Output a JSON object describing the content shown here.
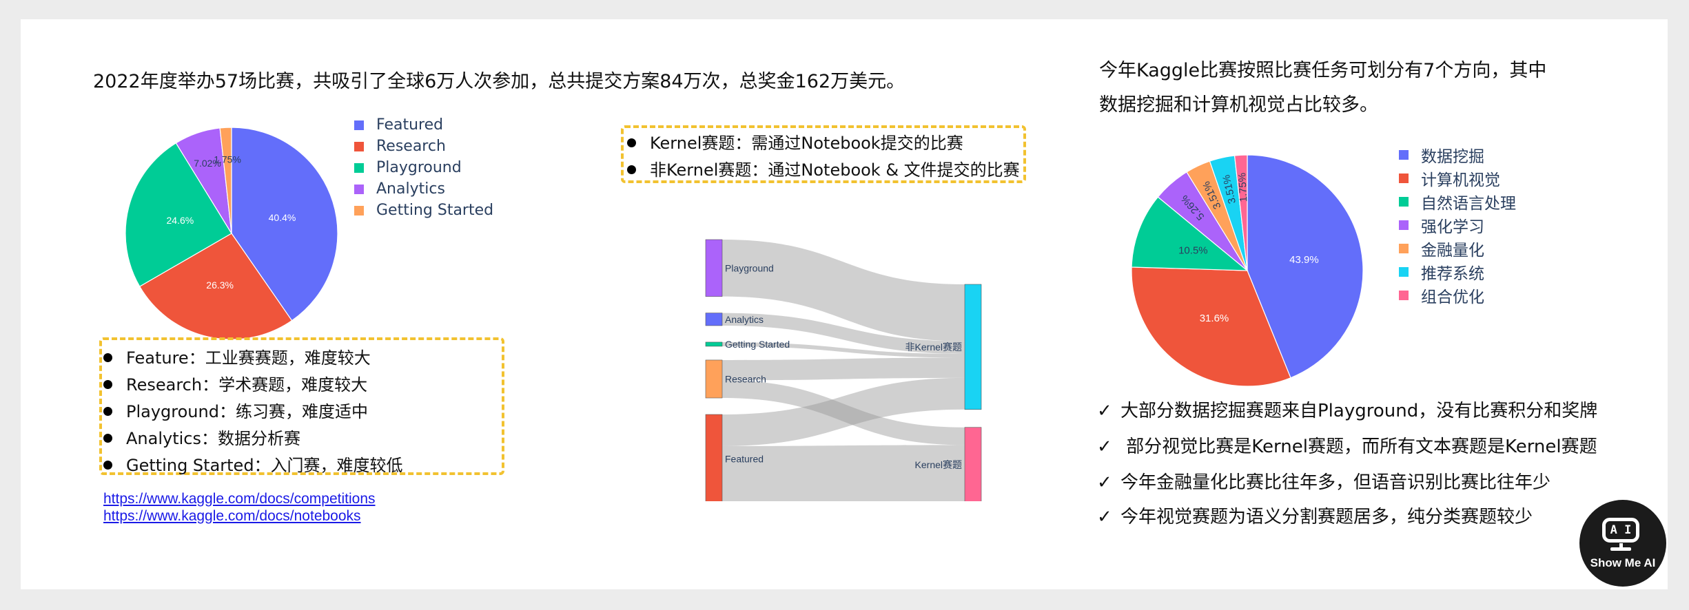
{
  "left_section": {
    "headline": "2022年度举办57场比赛，共吸引了全球6万人次参加，总共提交方案84万次，总奖金162万美元。",
    "bullets": [
      {
        "label": "Feature：",
        "desc": "工业赛赛题，难度较大"
      },
      {
        "label": "Research：",
        "desc": "学术赛题，难度较大"
      },
      {
        "label": "Playground：",
        "desc": "练习赛，难度适中"
      },
      {
        "label": "Analytics：",
        "desc": "数据分析赛"
      },
      {
        "label": "Getting Started：",
        "desc": "入门赛，难度较低"
      }
    ],
    "links": [
      "https://www.kaggle.com/docs/competitions",
      "https://www.kaggle.com/docs/notebooks"
    ]
  },
  "middle_section": {
    "notes": [
      "Kernel赛题：需通过Notebook提交的比赛",
      "非Kernel赛题：通过Notebook & 文件提交的比赛"
    ]
  },
  "right_section": {
    "headline_line1": "今年Kaggle比赛按照比赛任务可划分有7个方向，其中",
    "headline_line2": "数据挖掘和计算机视觉占比较多。",
    "check_items": [
      "大部分数据挖掘赛题来自Playground，没有比赛积分和奖牌",
      " 部分视觉比赛是Kernel赛题，而所有文本赛题是Kernel赛题",
      "今年金融量化比赛比往年多，但语音识别比赛比往年少",
      "今年视觉赛题为语义分割赛题居多，纯分类赛题较少"
    ],
    "check_mark": "✓"
  },
  "logo": {
    "icon_text": "A I",
    "text": "Show Me AI"
  },
  "chart_data": [
    {
      "type": "pie",
      "title": "",
      "labels": [
        "Featured",
        "Research",
        "Playground",
        "Analytics",
        "Getting Started"
      ],
      "values": [
        40.4,
        26.3,
        24.6,
        7.02,
        1.75
      ],
      "value_labels": [
        "40.4%",
        "26.3%",
        "24.6%",
        "7.02%",
        "1.75%"
      ],
      "colors": [
        "#636efa",
        "#ef553b",
        "#00cc96",
        "#ab63fa",
        "#ffa15a"
      ],
      "legend_position": "right"
    },
    {
      "type": "sankey",
      "nodes": [
        {
          "name": "Playground",
          "color": "#ab63fa"
        },
        {
          "name": "Analytics",
          "color": "#636efa"
        },
        {
          "name": "Getting Started",
          "color": "#00cc96"
        },
        {
          "name": "Research",
          "color": "#ffa15a"
        },
        {
          "name": "Featured",
          "color": "#ef553b"
        },
        {
          "name": "非Kernel赛题",
          "color": "#19d3f3"
        },
        {
          "name": "Kernel赛题",
          "color": "#ff6692"
        }
      ],
      "links": [
        {
          "source": "Playground",
          "target": "非Kernel赛题",
          "value": 9
        },
        {
          "source": "Analytics",
          "target": "非Kernel赛题",
          "value": 2
        },
        {
          "source": "Getting Started",
          "target": "非Kernel赛题",
          "value": 0.6
        },
        {
          "source": "Research",
          "target": "非Kernel赛题",
          "value": 3.2
        },
        {
          "source": "Research",
          "target": "Kernel赛题",
          "value": 2.8
        },
        {
          "source": "Featured",
          "target": "非Kernel赛题",
          "value": 5
        },
        {
          "source": "Featured",
          "target": "Kernel赛题",
          "value": 9
        }
      ]
    },
    {
      "type": "pie",
      "title": "",
      "labels": [
        "数据挖掘",
        "计算机视觉",
        "自然语言处理",
        "强化学习",
        "金融量化",
        "推荐系统",
        "组合优化"
      ],
      "values": [
        43.9,
        31.6,
        10.5,
        5.26,
        3.51,
        3.51,
        1.75
      ],
      "value_labels": [
        "43.9%",
        "31.6%",
        "10.5%",
        "5.26%",
        "3.51%",
        "3.51%",
        "1.75%"
      ],
      "colors": [
        "#636efa",
        "#ef553b",
        "#00cc96",
        "#ab63fa",
        "#ffa15a",
        "#19d3f3",
        "#ff6692"
      ],
      "legend_position": "right"
    }
  ]
}
